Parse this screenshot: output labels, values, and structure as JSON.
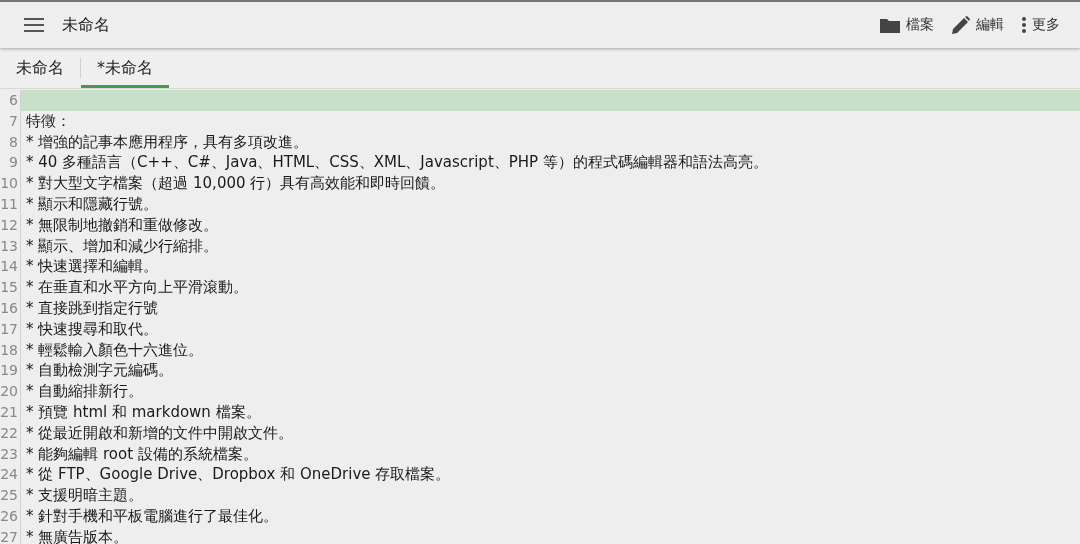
{
  "toolbar": {
    "title": "未命名",
    "actions": [
      {
        "kind": "folder",
        "label": "檔案"
      },
      {
        "kind": "pencil",
        "label": "編輯"
      },
      {
        "kind": "more",
        "label": "更多"
      }
    ]
  },
  "tabs": [
    {
      "label": "未命名",
      "selected": false
    },
    {
      "label": "*未命名",
      "selected": true
    }
  ],
  "editor": {
    "lines": [
      {
        "number": "6",
        "current": true
      },
      {
        "number": "7",
        "text": "特徵：",
        "current": false
      },
      {
        "number": "8",
        "text": "* 增強的記事本應用程序，具有多項改進。",
        "current": false
      },
      {
        "number": "9",
        "text": "* 40 多種語言（C++、C#、Java、HTML、CSS、XML、Javascript、PHP 等）的程式碼編輯器和語法高亮。",
        "current": false
      },
      {
        "number": "10",
        "text": "* 對大型文字檔案（超過 10,000 行）具有高效能和即時回饋。",
        "current": false
      },
      {
        "number": "11",
        "text": "* 顯示和隱藏行號。",
        "current": false
      },
      {
        "number": "12",
        "text": "* 無限制地撤銷和重做修改。",
        "current": false
      },
      {
        "number": "13",
        "text": "* 顯示、增加和減少行縮排。",
        "current": false
      },
      {
        "number": "14",
        "text": "* 快速選擇和編輯。",
        "current": false
      },
      {
        "number": "15",
        "text": "* 在垂直和水平方向上平滑滾動。",
        "current": false
      },
      {
        "number": "16",
        "text": "* 直接跳到指定行號",
        "current": false
      },
      {
        "number": "17",
        "text": "* 快速搜尋和取代。",
        "current": false
      },
      {
        "number": "18",
        "text": "* 輕鬆輸入顏色十六進位。",
        "current": false
      },
      {
        "number": "19",
        "text": "* 自動檢測字元編碼。",
        "current": false
      },
      {
        "number": "20",
        "text": "* 自動縮排新行。",
        "current": false
      },
      {
        "number": "21",
        "text": "* 預覽 html 和 markdown 檔案。",
        "current": false
      },
      {
        "number": "22",
        "text": "* 從最近開啟和新增的文件中開啟文件。",
        "current": false
      },
      {
        "number": "23",
        "text": "* 能夠編輯 root 設備的系統檔案。",
        "current": false
      },
      {
        "number": "24",
        "text": "* 從 FTP、Google Drive、Dropbox 和 OneDrive 存取檔案。",
        "current": false
      },
      {
        "number": "25",
        "text": "* 支援明暗主題。",
        "current": false
      },
      {
        "number": "26",
        "text": "* 針對手機和平板電腦進行了最佳化。",
        "current": false
      },
      {
        "number": "27",
        "text": "* 無廣告版本。",
        "current": false
      }
    ]
  }
}
